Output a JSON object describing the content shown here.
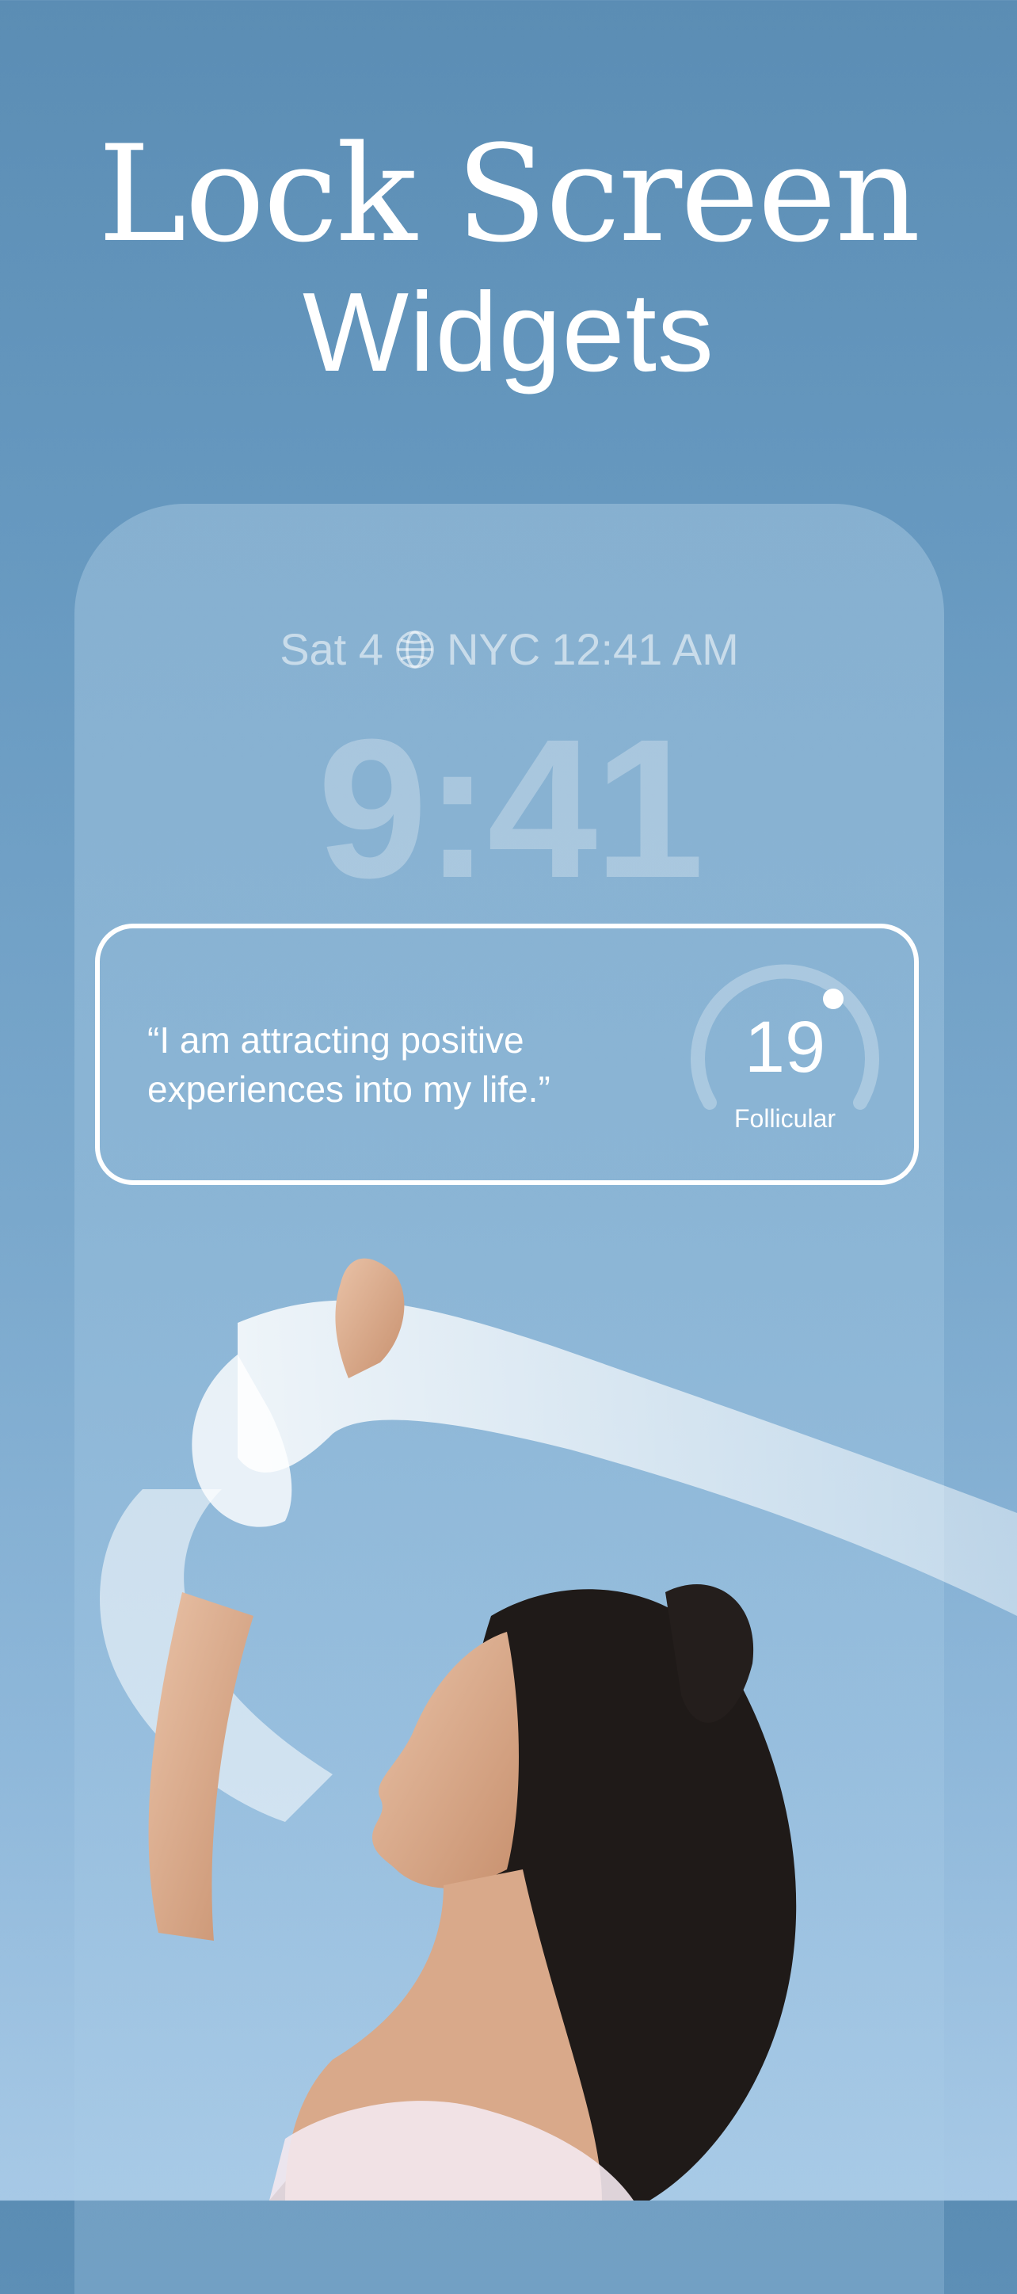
{
  "header": {
    "title_line1": "Lock Screen",
    "title_line2": "Widgets"
  },
  "lock_screen": {
    "date_label": "Sat 4",
    "world_clock_city": "NYC",
    "world_clock_time": "12:41 AM",
    "time": "9:41"
  },
  "widget": {
    "affirmation": "“I am attracting positive experiences into my life.”",
    "cycle_day": "19",
    "cycle_phase": "Follicular"
  },
  "colors": {
    "background": "#6799c0",
    "text": "#ffffff"
  }
}
